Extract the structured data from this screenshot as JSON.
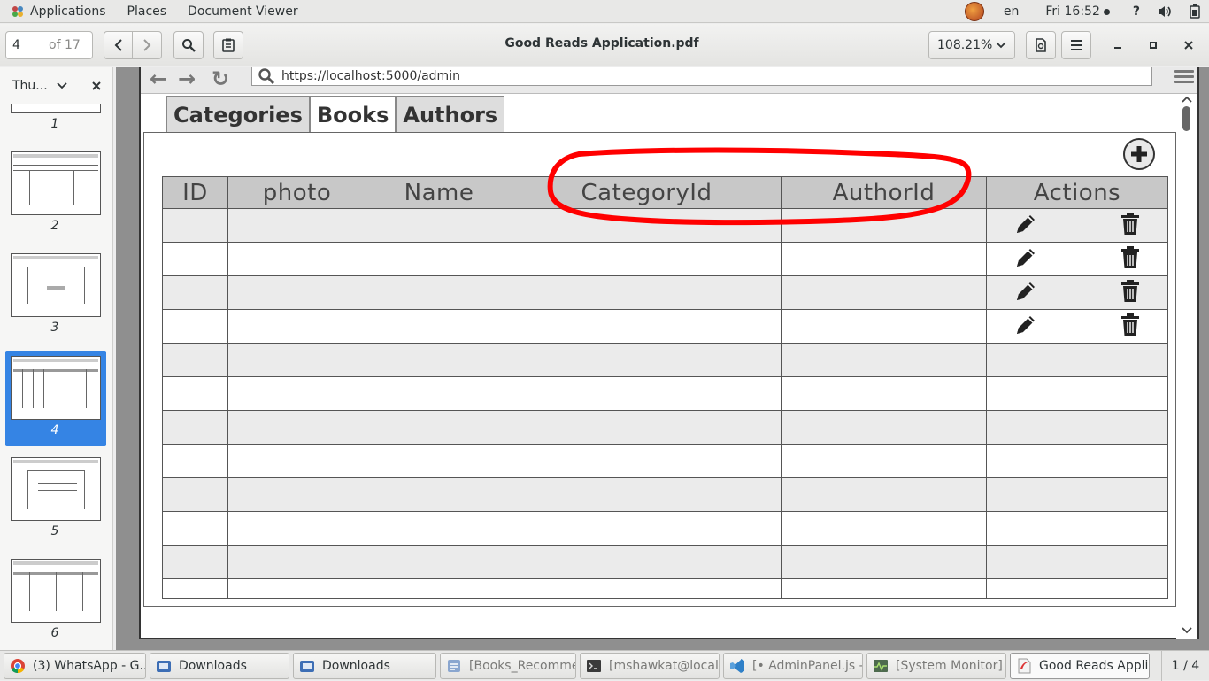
{
  "topbar": {
    "applications": "Applications",
    "places": "Places",
    "app_name": "Document Viewer",
    "language": "en",
    "clock": "Fri 16:52"
  },
  "headerbar": {
    "page_current": "4",
    "page_total": "of 17",
    "title": "Good Reads Application.pdf",
    "zoom": "108.21%"
  },
  "sidebar": {
    "mode_label": "Thu...",
    "thumbnails": [
      {
        "number": "1"
      },
      {
        "number": "2"
      },
      {
        "number": "3"
      },
      {
        "number": "4",
        "selected": true
      },
      {
        "number": "5"
      },
      {
        "number": "6"
      }
    ]
  },
  "document": {
    "url": "https://localhost:5000/admin",
    "tabs": [
      {
        "label": "Categories",
        "active": false
      },
      {
        "label": "Books",
        "active": true
      },
      {
        "label": "Authors",
        "active": false
      }
    ],
    "table": {
      "columns": [
        "ID",
        "photo",
        "Name",
        "CategoryId",
        "AuthorId",
        "Actions"
      ],
      "rows_with_actions": 4,
      "total_rows": 12
    },
    "annotation_color": "#ff0000"
  },
  "taskbar": {
    "tasks": [
      {
        "label": "(3) WhatsApp - G...",
        "icon": "chrome-icon"
      },
      {
        "label": "Downloads",
        "icon": "folder-icon"
      },
      {
        "label": "Downloads",
        "icon": "folder-icon"
      },
      {
        "label": "[Books_Recomme...",
        "icon": "file-manager-icon",
        "dim": true
      },
      {
        "label": "[mshawkat@localh...",
        "icon": "terminal-icon",
        "dim": true
      },
      {
        "label": "[• AdminPanel.js - ...",
        "icon": "vscode-icon",
        "dim": true
      },
      {
        "label": "[System Monitor]",
        "icon": "system-monitor-icon",
        "dim": true
      },
      {
        "label": "Good Reads Applic...",
        "icon": "document-viewer-icon",
        "active": true
      }
    ],
    "workspace": "1 / 4"
  },
  "colors": {
    "selection_blue": "#3584e4",
    "annotation_red": "#ff0000"
  }
}
